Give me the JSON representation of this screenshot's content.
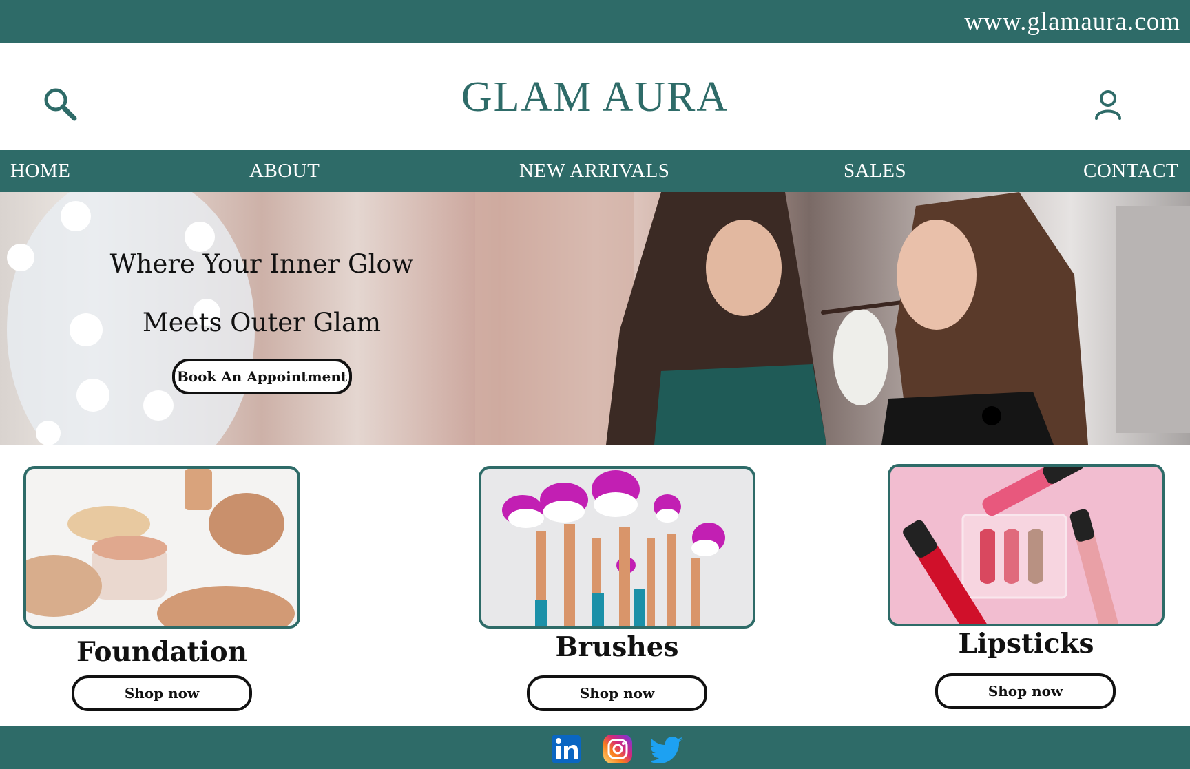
{
  "topbar": {
    "url": "www.glamaura.com"
  },
  "header": {
    "brand": "GLAM AURA"
  },
  "nav": {
    "items": [
      {
        "label": "HOME"
      },
      {
        "label": "ABOUT"
      },
      {
        "label": "NEW ARRIVALS"
      },
      {
        "label": "SALES"
      },
      {
        "label": "CONTACT"
      }
    ]
  },
  "hero": {
    "line1": "Where Your Inner Glow",
    "line2": "Meets Outer Glam",
    "button": "Book An Appointment"
  },
  "categories": [
    {
      "title": "Foundation",
      "button": "Shop now"
    },
    {
      "title": "Brushes",
      "button": "Shop now"
    },
    {
      "title": "Lipsticks",
      "button": "Shop now"
    }
  ],
  "colors": {
    "brand": "#2e6b68",
    "background": "#ffffff",
    "text": "#111111"
  },
  "footer": {
    "social": [
      "linkedin-icon",
      "instagram-icon",
      "twitter-icon"
    ]
  }
}
